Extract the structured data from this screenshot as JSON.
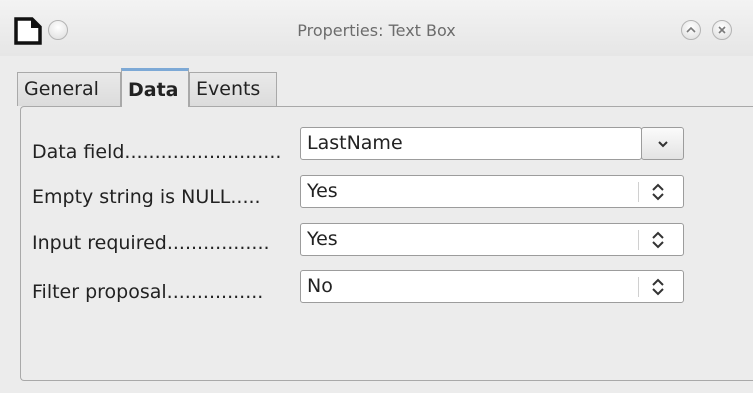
{
  "window": {
    "title": "Properties: Text Box"
  },
  "tabs": [
    {
      "label": "General"
    },
    {
      "label": "Data"
    },
    {
      "label": "Events"
    }
  ],
  "fields": [
    {
      "label": "Data field..........................",
      "value": "LastName",
      "control": "combobox"
    },
    {
      "label": "Empty string is NULL.....",
      "value": "Yes",
      "control": "spin"
    },
    {
      "label": "Input required.................",
      "value": "Yes",
      "control": "spin"
    },
    {
      "label": "Filter proposal................",
      "value": "No",
      "control": "spin"
    }
  ],
  "icons": {
    "app": "document-icon",
    "menu": "window-menu-icon",
    "shade": "shade-icon",
    "close": "close-icon",
    "dropdown": "chevron-down-icon",
    "spin": "up-down-arrows-icon"
  },
  "colors": {
    "active_tab_accent": "#7da9d6",
    "background": "#ececec"
  }
}
